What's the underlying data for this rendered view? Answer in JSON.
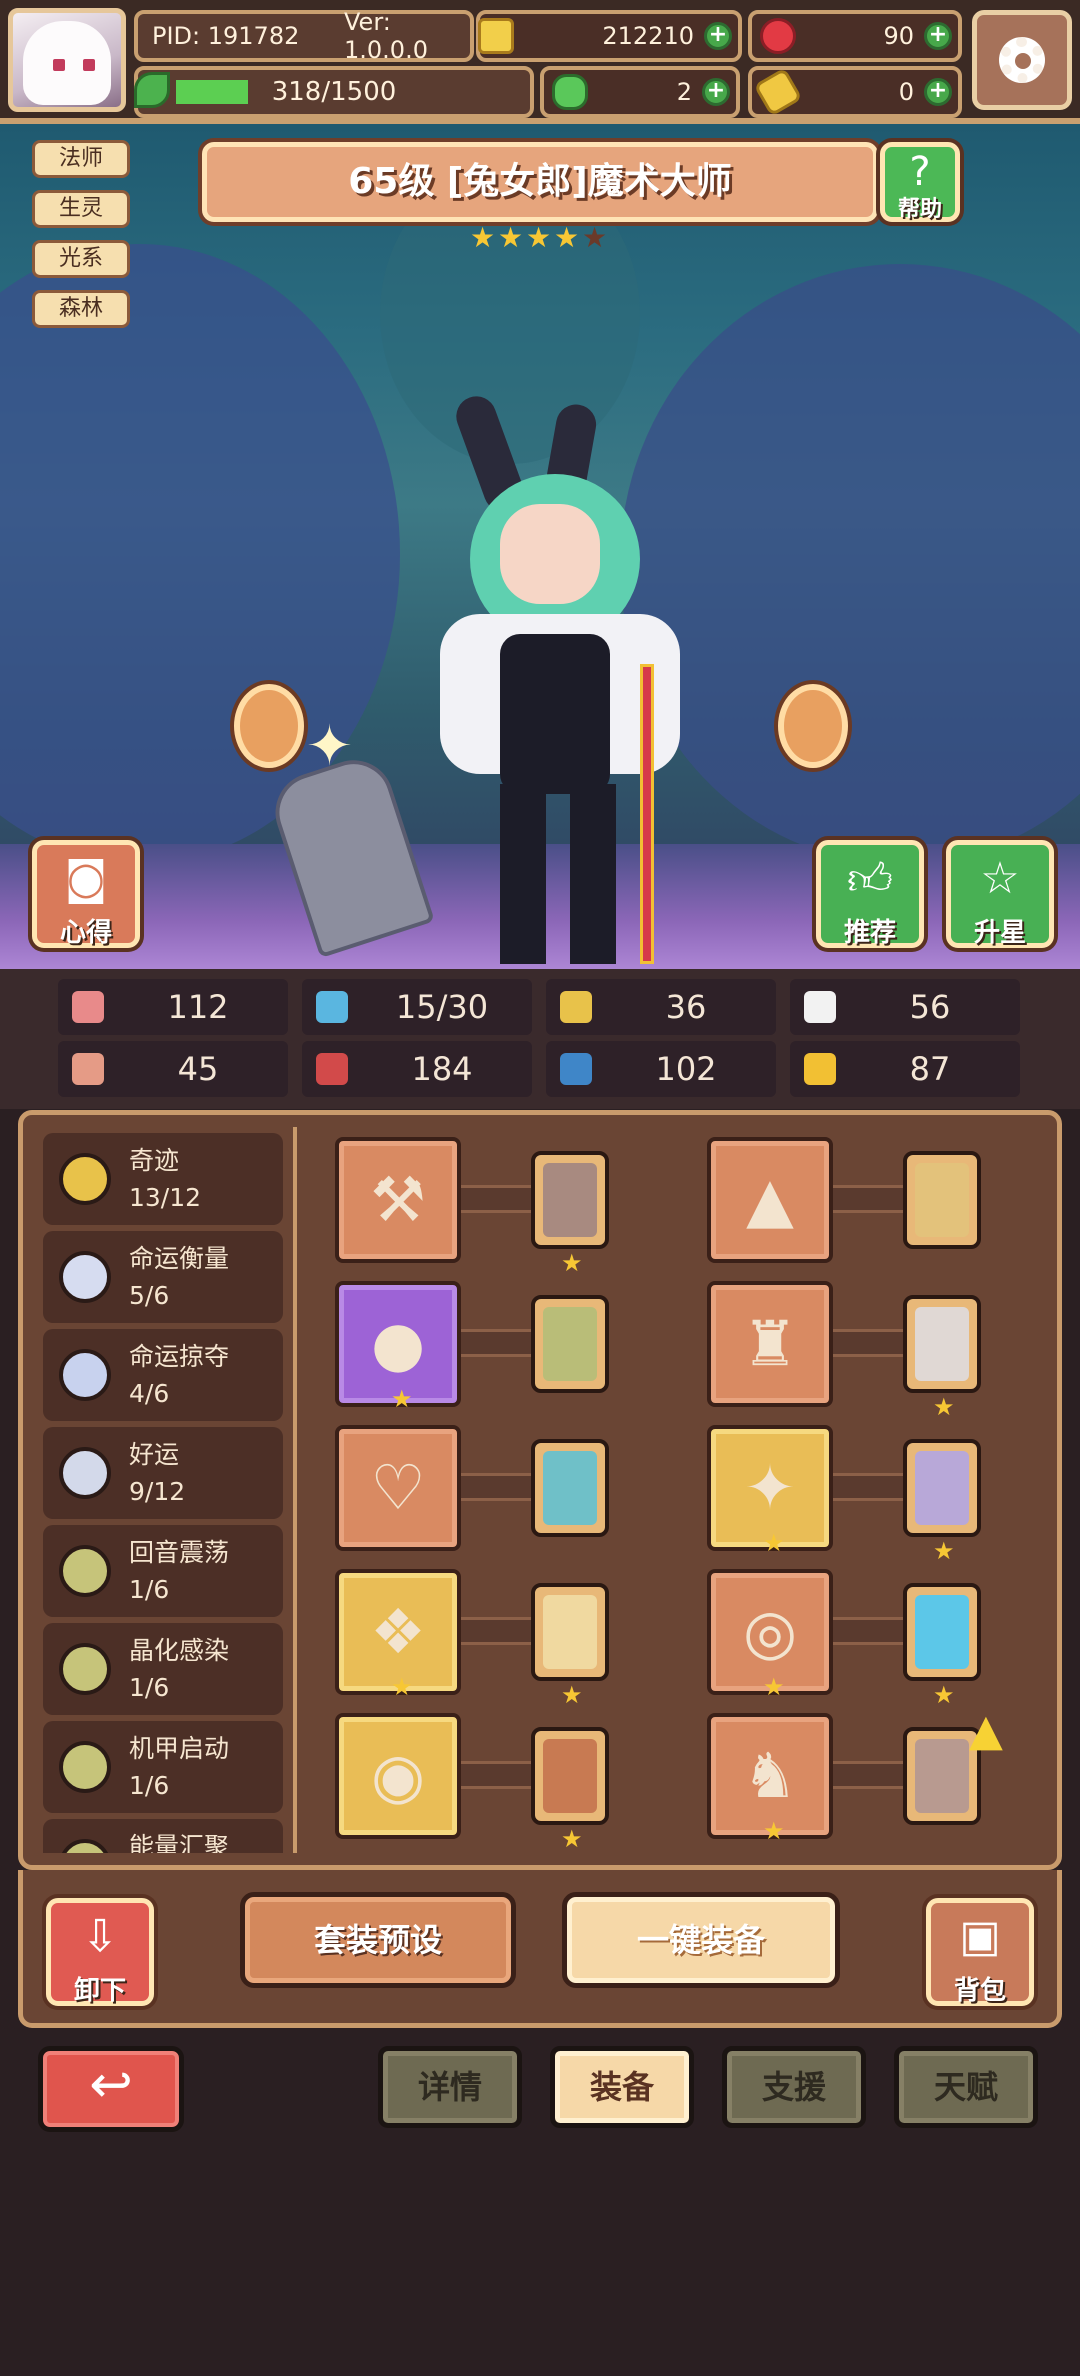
{
  "topbar": {
    "pid": "PID: 191782",
    "version": "Ver: 1.0.0.0",
    "gold": "212210",
    "gems": "90",
    "exp": "318/1500",
    "exp_fraction": 0.212,
    "clover": "2",
    "bone": "0"
  },
  "hero": {
    "title": "65级 [兔女郎]魔术大师",
    "stars_filled": 4,
    "stars_total": 5,
    "tags": [
      "法师",
      "生灵",
      "光系",
      "森林"
    ],
    "help_label": "帮助",
    "notes_label": "心得",
    "recommend_label": "推荐",
    "upstar_label": "升星"
  },
  "stats": [
    {
      "icon": "heart-icon",
      "value": "112",
      "color": "#e88a8a"
    },
    {
      "icon": "mana-drop-icon",
      "value": "15/30",
      "color": "#5ab6e0"
    },
    {
      "icon": "shield-icon",
      "value": "36",
      "color": "#e8c24a"
    },
    {
      "icon": "wing-icon",
      "value": "56",
      "color": "#f2f2f2"
    },
    {
      "icon": "fist-icon",
      "value": "45",
      "color": "#e59b86"
    },
    {
      "icon": "book-icon",
      "value": "184",
      "color": "#d24a4a"
    },
    {
      "icon": "boot-icon",
      "value": "102",
      "color": "#3f86c8"
    },
    {
      "icon": "horseshoe-icon",
      "value": "87",
      "color": "#f2c033"
    }
  ],
  "sets": [
    {
      "name": "奇迹",
      "count": "13/12",
      "color": "#e8c24a"
    },
    {
      "name": "命运衡量",
      "count": "5/6",
      "color": "#d6dcf0"
    },
    {
      "name": "命运掠夺",
      "count": "4/6",
      "color": "#c8d2ee"
    },
    {
      "name": "好运",
      "count": "9/12",
      "color": "#d3d9ea"
    },
    {
      "name": "回音震荡",
      "count": "1/6",
      "color": "#c6c47a"
    },
    {
      "name": "晶化感染",
      "count": "1/6",
      "color": "#c6c47a"
    },
    {
      "name": "机甲启动",
      "count": "1/6",
      "color": "#c6c47a"
    },
    {
      "name": "能量汇聚",
      "count": "",
      "color": "#c6c47a"
    }
  ],
  "equipment": [
    {
      "slot": "weapon-axe",
      "glyph": "⚒",
      "rarity": "plain",
      "card_color": "#a88a80",
      "stars": 1,
      "item_star": false
    },
    {
      "slot": "hat",
      "glyph": "▲",
      "rarity": "plain",
      "card_color": "#e3c27b",
      "stars": 0,
      "item_star": false
    },
    {
      "slot": "orb",
      "glyph": "●",
      "rarity": "purple",
      "card_color": "#b9bd78",
      "stars": 0,
      "item_star": true
    },
    {
      "slot": "armor",
      "glyph": "♜",
      "rarity": "plain",
      "card_color": "#e0d8d4",
      "stars": 1,
      "item_star": false
    },
    {
      "slot": "necklace",
      "glyph": "♡",
      "rarity": "plain",
      "card_color": "#6fc0c8",
      "stars": 0,
      "item_star": false
    },
    {
      "slot": "bracer",
      "glyph": "✦",
      "rarity": "gold",
      "card_color": "#b8a8d8",
      "stars": 1,
      "item_star": true
    },
    {
      "slot": "amulet",
      "glyph": "❖",
      "rarity": "gold",
      "card_color": "#f0d9a0",
      "stars": 1,
      "item_star": true
    },
    {
      "slot": "belt",
      "glyph": "◎",
      "rarity": "plain",
      "card_color": "#5cc7e8",
      "stars": 1,
      "item_star": true
    },
    {
      "slot": "ring",
      "glyph": "◉",
      "rarity": "gold",
      "card_color": "#c87a52",
      "stars": 1,
      "item_star": false
    },
    {
      "slot": "boots",
      "glyph": "♞",
      "rarity": "plain",
      "card_color": "#b89a90",
      "stars": 0,
      "item_star": true
    }
  ],
  "actions": {
    "unequip": "卸下",
    "preset": "套装预设",
    "auto_equip": "一键装备",
    "bag": "背包"
  },
  "tabs": {
    "details": "详情",
    "equip": "装备",
    "support": "支援",
    "talent": "天赋",
    "active": "equip"
  }
}
